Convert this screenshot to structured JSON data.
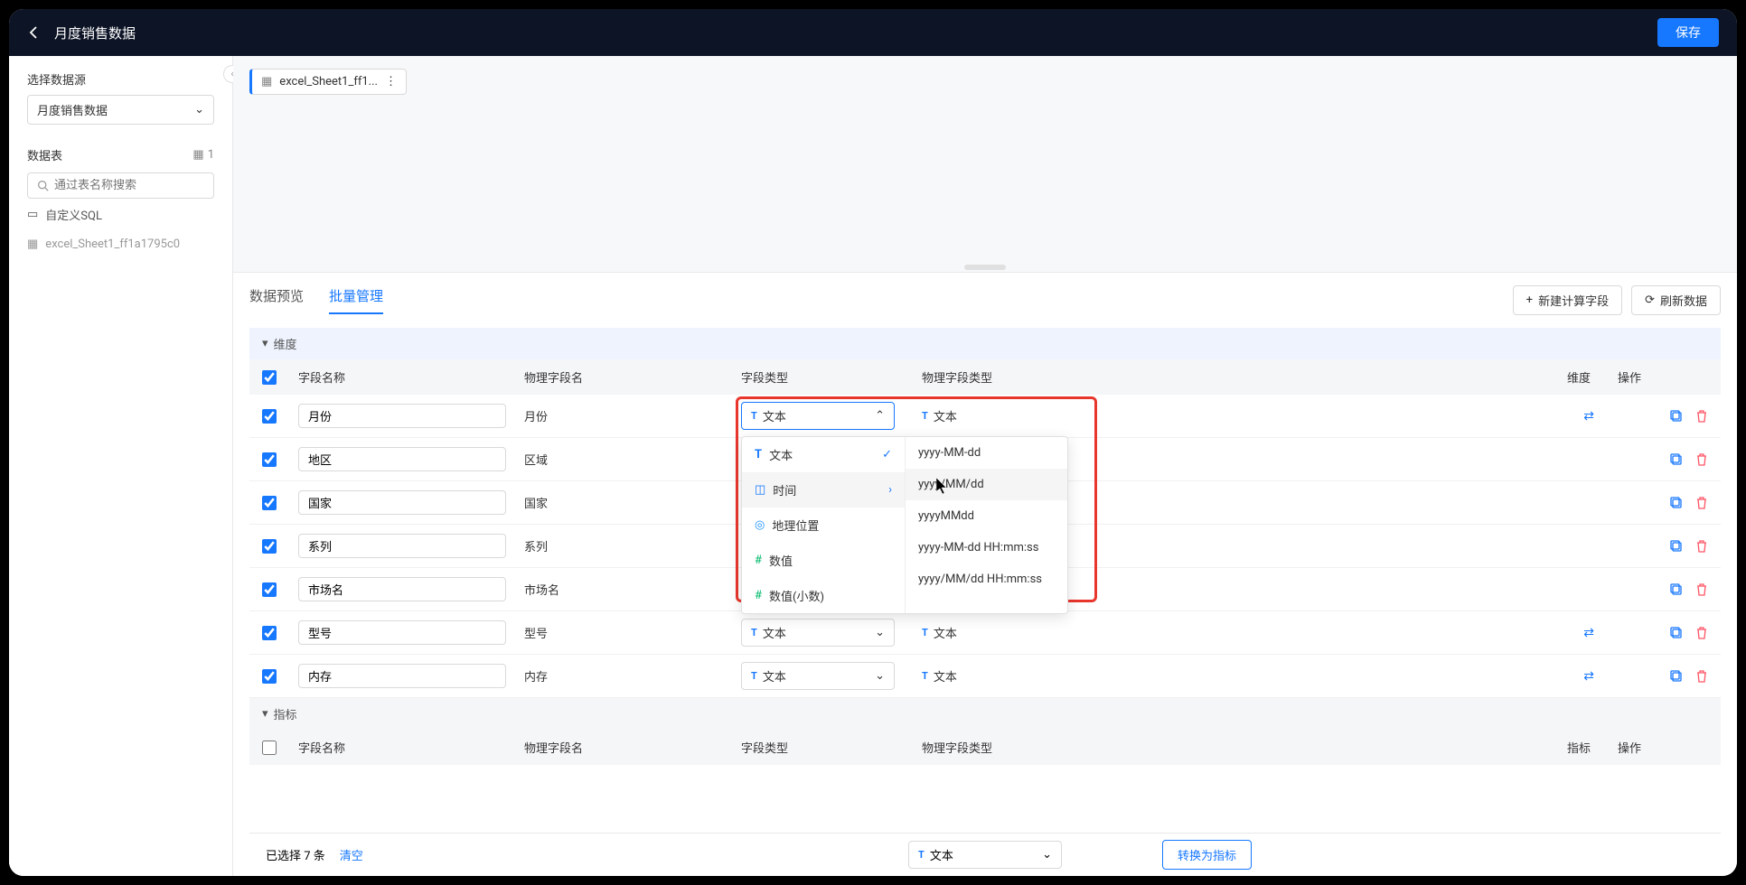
{
  "topbar": {
    "title": "月度销售数据",
    "save": "保存"
  },
  "sidebar": {
    "datasource_label": "选择数据源",
    "datasource_value": "月度销售数据",
    "tables_label": "数据表",
    "tables_count": "1",
    "search_placeholder": "通过表名称搜索",
    "custom_sql": "自定义SQL",
    "table_name": "excel_Sheet1_ff1a1795c0"
  },
  "canvas": {
    "source_name": "excel_Sheet1_ff1..."
  },
  "tabs": {
    "preview": "数据预览",
    "batch": "批量管理"
  },
  "head_btns": {
    "new_field": "新建计算字段",
    "refresh": "刷新数据"
  },
  "groups": {
    "dimension": "维度",
    "metric": "指标"
  },
  "columns": {
    "field_name": "字段名称",
    "phys_name": "物理字段名",
    "field_type": "字段类型",
    "phys_type": "物理字段类型",
    "dimension": "维度",
    "metric": "指标",
    "actions": "操作"
  },
  "type_text": "文本",
  "rows": [
    {
      "name": "月份",
      "phys": "月份",
      "open": true
    },
    {
      "name": "地区",
      "phys": "区域"
    },
    {
      "name": "国家",
      "phys": "国家"
    },
    {
      "name": "系列",
      "phys": "系列"
    },
    {
      "name": "市场名",
      "phys": "市场名"
    },
    {
      "name": "型号",
      "phys": "型号"
    },
    {
      "name": "内存",
      "phys": "内存"
    }
  ],
  "dropdown": {
    "types": [
      {
        "label": "文本",
        "icon": "T",
        "cls": "ic-text",
        "checked": true
      },
      {
        "label": "时间",
        "icon": "◫",
        "cls": "ic-time",
        "submenu": true,
        "hover": true
      },
      {
        "label": "地理位置",
        "icon": "◎",
        "cls": "ic-geo"
      },
      {
        "label": "数值",
        "icon": "#",
        "cls": "ic-num"
      },
      {
        "label": "数值(小数)",
        "icon": "#",
        "cls": "ic-num"
      }
    ],
    "formats": [
      "yyyy-MM-dd",
      "yyyy/MM/dd",
      "yyyyMMdd",
      "yyyy-MM-dd HH:mm:ss",
      "yyyy/MM/dd HH:mm:ss"
    ]
  },
  "footer": {
    "selected": "已选择 7 条",
    "clear": "清空",
    "convert": "转换为指标"
  }
}
